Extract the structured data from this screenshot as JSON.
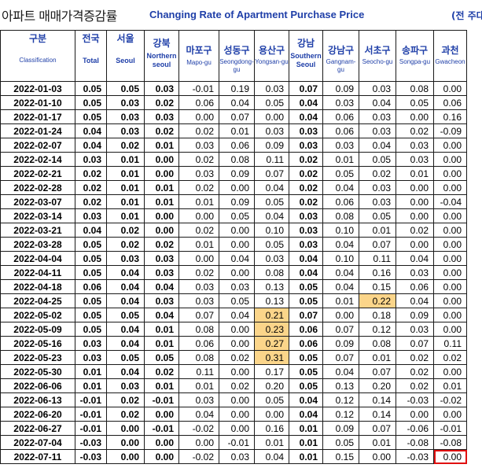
{
  "title": {
    "korean": "아파트 매매가격증감률",
    "english": "Changing Rate of Apartment Purchase Price",
    "unit": "(전 주대"
  },
  "columns": [
    {
      "ko": "구분",
      "en": "Classification"
    },
    {
      "ko": "전국",
      "en": "Total"
    },
    {
      "ko": "서울",
      "en": "Seoul"
    },
    {
      "ko": "강북",
      "en": "Northern seoul"
    },
    {
      "ko": "마포구",
      "en": "Mapo-gu"
    },
    {
      "ko": "성동구",
      "en": "Seongdong-gu"
    },
    {
      "ko": "용산구",
      "en": "Yongsan-gu"
    },
    {
      "ko": "강남",
      "en": "Southern Seoul"
    },
    {
      "ko": "강남구",
      "en": "Gangnam-gu"
    },
    {
      "ko": "서초구",
      "en": "Seocho-gu"
    },
    {
      "ko": "송파구",
      "en": "Songpa-gu"
    },
    {
      "ko": "과천",
      "en": "Gwacheon"
    }
  ],
  "rows": [
    [
      "2022-01-03",
      "0.05",
      "0.05",
      "0.03",
      "-0.01",
      "0.19",
      "0.03",
      "0.07",
      "0.09",
      "0.03",
      "0.08",
      "0.00"
    ],
    [
      "2022-01-10",
      "0.05",
      "0.03",
      "0.02",
      "0.06",
      "0.04",
      "0.05",
      "0.04",
      "0.03",
      "0.04",
      "0.05",
      "0.06"
    ],
    [
      "2022-01-17",
      "0.05",
      "0.03",
      "0.03",
      "0.00",
      "0.07",
      "0.00",
      "0.04",
      "0.06",
      "0.03",
      "0.00",
      "0.16"
    ],
    [
      "2022-01-24",
      "0.04",
      "0.03",
      "0.02",
      "0.02",
      "0.01",
      "0.03",
      "0.03",
      "0.06",
      "0.03",
      "0.02",
      "-0.09"
    ],
    [
      "2022-02-07",
      "0.04",
      "0.02",
      "0.01",
      "0.03",
      "0.06",
      "0.09",
      "0.03",
      "0.03",
      "0.04",
      "0.03",
      "0.00"
    ],
    [
      "2022-02-14",
      "0.03",
      "0.01",
      "0.00",
      "0.02",
      "0.08",
      "0.11",
      "0.02",
      "0.01",
      "0.05",
      "0.03",
      "0.00"
    ],
    [
      "2022-02-21",
      "0.02",
      "0.01",
      "0.00",
      "0.03",
      "0.09",
      "0.07",
      "0.02",
      "0.05",
      "0.02",
      "0.01",
      "0.00"
    ],
    [
      "2022-02-28",
      "0.02",
      "0.01",
      "0.01",
      "0.02",
      "0.00",
      "0.04",
      "0.02",
      "0.04",
      "0.03",
      "0.00",
      "0.00"
    ],
    [
      "2022-03-07",
      "0.02",
      "0.01",
      "0.01",
      "0.01",
      "0.09",
      "0.05",
      "0.02",
      "0.06",
      "0.03",
      "0.00",
      "-0.04"
    ],
    [
      "2022-03-14",
      "0.03",
      "0.01",
      "0.00",
      "0.00",
      "0.05",
      "0.04",
      "0.03",
      "0.08",
      "0.05",
      "0.00",
      "0.00"
    ],
    [
      "2022-03-21",
      "0.04",
      "0.02",
      "0.00",
      "0.02",
      "0.00",
      "0.10",
      "0.03",
      "0.10",
      "0.01",
      "0.02",
      "0.00"
    ],
    [
      "2022-03-28",
      "0.05",
      "0.02",
      "0.02",
      "0.01",
      "0.00",
      "0.05",
      "0.03",
      "0.04",
      "0.07",
      "0.00",
      "0.00"
    ],
    [
      "2022-04-04",
      "0.05",
      "0.03",
      "0.03",
      "0.00",
      "0.04",
      "0.03",
      "0.04",
      "0.10",
      "0.11",
      "0.04",
      "0.00"
    ],
    [
      "2022-04-11",
      "0.05",
      "0.04",
      "0.03",
      "0.02",
      "0.00",
      "0.08",
      "0.04",
      "0.04",
      "0.16",
      "0.03",
      "0.00"
    ],
    [
      "2022-04-18",
      "0.06",
      "0.04",
      "0.04",
      "0.03",
      "0.03",
      "0.13",
      "0.05",
      "0.04",
      "0.15",
      "0.06",
      "0.00"
    ],
    [
      "2022-04-25",
      "0.05",
      "0.04",
      "0.03",
      "0.03",
      "0.05",
      "0.13",
      "0.05",
      "0.01",
      "0.22",
      "0.04",
      "0.00"
    ],
    [
      "2022-05-02",
      "0.05",
      "0.05",
      "0.04",
      "0.07",
      "0.04",
      "0.21",
      "0.07",
      "0.00",
      "0.18",
      "0.09",
      "0.00"
    ],
    [
      "2022-05-09",
      "0.05",
      "0.04",
      "0.01",
      "0.08",
      "0.00",
      "0.23",
      "0.06",
      "0.07",
      "0.12",
      "0.03",
      "0.00"
    ],
    [
      "2022-05-16",
      "0.03",
      "0.04",
      "0.01",
      "0.06",
      "0.00",
      "0.27",
      "0.06",
      "0.09",
      "0.08",
      "0.07",
      "0.11"
    ],
    [
      "2022-05-23",
      "0.03",
      "0.05",
      "0.05",
      "0.08",
      "0.02",
      "0.31",
      "0.05",
      "0.07",
      "0.01",
      "0.02",
      "0.02"
    ],
    [
      "2022-05-30",
      "0.01",
      "0.04",
      "0.02",
      "0.11",
      "0.00",
      "0.17",
      "0.05",
      "0.04",
      "0.07",
      "0.02",
      "0.00"
    ],
    [
      "2022-06-06",
      "0.01",
      "0.03",
      "0.01",
      "0.01",
      "0.02",
      "0.20",
      "0.05",
      "0.13",
      "0.20",
      "0.02",
      "0.01"
    ],
    [
      "2022-06-13",
      "-0.01",
      "0.02",
      "-0.01",
      "0.03",
      "0.00",
      "0.05",
      "0.04",
      "0.12",
      "0.14",
      "-0.03",
      "-0.02"
    ],
    [
      "2022-06-20",
      "-0.01",
      "0.02",
      "0.00",
      "0.04",
      "0.00",
      "0.00",
      "0.04",
      "0.12",
      "0.14",
      "0.00",
      "0.00"
    ],
    [
      "2022-06-27",
      "-0.01",
      "0.00",
      "-0.01",
      "-0.02",
      "0.00",
      "0.16",
      "0.01",
      "0.09",
      "0.07",
      "-0.06",
      "-0.01"
    ],
    [
      "2022-07-04",
      "-0.03",
      "0.00",
      "0.00",
      "0.00",
      "-0.01",
      "0.01",
      "0.01",
      "0.05",
      "0.01",
      "-0.08",
      "-0.08"
    ],
    [
      "2022-07-11",
      "-0.03",
      "0.00",
      "0.00",
      "-0.02",
      "0.03",
      "0.04",
      "0.01",
      "0.15",
      "0.00",
      "-0.03",
      "0.00"
    ]
  ],
  "highlight_color": "#fbd58a",
  "selection_color": "#e01010",
  "selected_cell": {
    "row": 26,
    "col": 11
  }
}
